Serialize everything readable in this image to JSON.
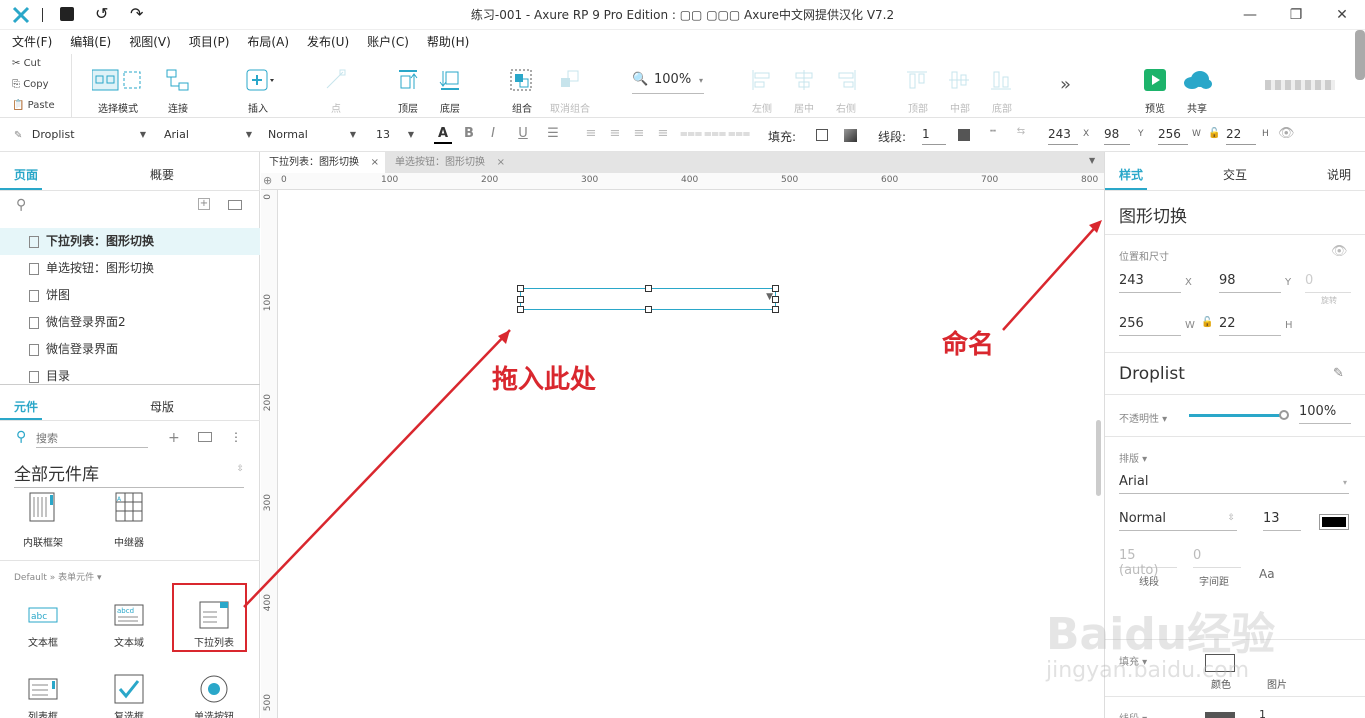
{
  "app": {
    "title": "练习-001 - Axure RP 9 Pro Edition : ▢▢ ▢▢▢   Axure中文网提供汉化 V7.2",
    "accent": "#2aa7c9"
  },
  "menu": [
    "文件(F)",
    "编辑(E)",
    "视图(V)",
    "项目(P)",
    "布局(A)",
    "发布(U)",
    "账户(C)",
    "帮助(H)"
  ],
  "clipboard": {
    "cut": "Cut",
    "copy": "Copy",
    "paste": "Paste"
  },
  "toolbar": {
    "select_mode": "选择模式",
    "connect": "连接",
    "insert": "插入",
    "point": "点",
    "top_layer": "顶层",
    "bottom_layer": "底层",
    "group": "组合",
    "ungroup": "取消组合",
    "zoom": "100%",
    "left": "左侧",
    "center": "居中",
    "right": "右侧",
    "top": "顶部",
    "middle": "中部",
    "bottom": "底部",
    "more": "»",
    "preview": "预览",
    "share": "共享"
  },
  "format": {
    "widget_type": "Droplist",
    "font": "Arial",
    "weight": "Normal",
    "size": "13",
    "fill_label": "填充:",
    "stroke_label": "线段:",
    "stroke_width": "1",
    "x": "243",
    "x_label": "X",
    "y": "98",
    "y_label": "Y",
    "w": "256",
    "w_label": "W",
    "h": "22",
    "h_label": "H"
  },
  "left": {
    "tabs": {
      "pages": "页面",
      "outline": "概要"
    },
    "pages": [
      {
        "label": "下拉列表：图形切换",
        "selected": true
      },
      {
        "label": "单选按钮：图形切换",
        "selected": false
      },
      {
        "label": "饼图",
        "selected": false
      },
      {
        "label": "微信登录界面2",
        "selected": false
      },
      {
        "label": "微信登录界面",
        "selected": false
      },
      {
        "label": "目录",
        "selected": false
      }
    ],
    "lib_tabs": {
      "widgets": "元件",
      "masters": "母版"
    },
    "search_placeholder": "搜索",
    "library": "全部元件库",
    "top_widgets": [
      {
        "label": "内联框架"
      },
      {
        "label": "中继器"
      }
    ],
    "section": "Default » 表单元件 ▾",
    "form_widgets": [
      {
        "label": "文本框"
      },
      {
        "label": "文本域"
      },
      {
        "label": "下拉列表"
      },
      {
        "label": "列表框"
      },
      {
        "label": "复选框"
      },
      {
        "label": "单选按钮"
      }
    ]
  },
  "canvas": {
    "tabs": [
      {
        "label": "下拉列表：图形切换",
        "active": true
      },
      {
        "label": "单选按钮：图形切换",
        "active": false
      }
    ],
    "ruler_h": [
      "0",
      "100",
      "200",
      "300",
      "400",
      "500",
      "600",
      "700",
      "800"
    ],
    "ruler_v": [
      "0",
      "100",
      "200",
      "300",
      "400",
      "500"
    ]
  },
  "right": {
    "tabs": {
      "style": "样式",
      "interact": "交互",
      "notes": "说明"
    },
    "name": "图形切换",
    "pos_size_label": "位置和尺寸",
    "x": "243",
    "x_lbl": "X",
    "y": "98",
    "y_lbl": "Y",
    "rot": "0",
    "rot_lbl": "旋转",
    "w": "256",
    "w_lbl": "W",
    "h": "22",
    "h_lbl": "H",
    "widget_type": "Droplist",
    "opacity_label": "不透明性 ▾",
    "opacity": "100%",
    "opacity_value": 1.0,
    "typography_label": "排版 ▾",
    "font": "Arial",
    "weight": "Normal",
    "size": "13",
    "line_height": "15 (auto)",
    "line_height_lbl": "线段",
    "letter_spacing": "0",
    "letter_spacing_lbl": "字间距",
    "aa": "Aa",
    "fill_label": "填充 ▾",
    "fill_color": "颜色",
    "fill_image": "图片",
    "stroke_label": "线段 ▾",
    "stroke_width": "1"
  },
  "annotations": {
    "drag_here": "拖入此处",
    "name_it": "命名",
    "color": "#d9272e"
  },
  "watermark": {
    "logo": "Baidu经验",
    "url": "jingyan.baidu.com"
  }
}
